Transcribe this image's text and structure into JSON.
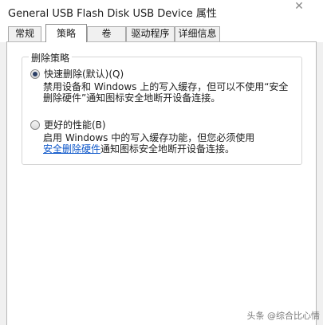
{
  "window": {
    "title": "General USB Flash Disk USB Device 属性",
    "close_glyph": "✕"
  },
  "tabs": [
    {
      "label": "常规"
    },
    {
      "label": "策略"
    },
    {
      "label": "卷"
    },
    {
      "label": "驱动程序"
    },
    {
      "label": "详细信息"
    }
  ],
  "active_tab": "策略",
  "removal_policy": {
    "group_title": "删除策略",
    "quick_removal": {
      "label": "快速删除(默认)(Q)",
      "selected": true,
      "desc_line1": "禁用设备和 Windows 上的写入缓存，但可以不使用“安全",
      "desc_line2_prefix": "删除硬件",
      "desc_line2_suffix": "”通知图标安全地断开设备连接。"
    },
    "better_performance": {
      "label": "更好的性能(B)",
      "selected": false,
      "desc_line1": "启用 Windows 中的写入缓存功能，但您必须使用",
      "desc_link": "安全删除硬件",
      "desc_line2_suffix": "通知图标安全地断开设备连接。"
    }
  },
  "watermark": "头条 @综合比心情"
}
